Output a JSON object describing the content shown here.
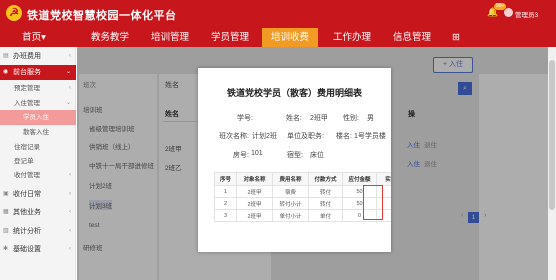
{
  "header": {
    "title": "铁道党校智慧校园一体化平台",
    "emblem_icon": "party-emblem-icon",
    "notification_count": "99+",
    "user": "管理员3"
  },
  "nav": {
    "items": [
      {
        "label": "首页▾"
      },
      {
        "label": "教务教学"
      },
      {
        "label": "培训管理"
      },
      {
        "label": "学员管理"
      },
      {
        "label": "培训收费"
      },
      {
        "label": "工作办理"
      },
      {
        "label": "信息管理"
      },
      {
        "label": "⊞"
      }
    ],
    "active": "培训收费"
  },
  "sidebar": {
    "items": [
      {
        "label": "办班费用",
        "icon": "file-icon"
      },
      {
        "label": "前台服务",
        "icon": "service-icon"
      },
      {
        "label": "预定管理"
      },
      {
        "label": "入住管理"
      },
      {
        "label": "学员入住"
      },
      {
        "label": "散客入住"
      },
      {
        "label": "住宿记录"
      },
      {
        "label": "登记单"
      },
      {
        "label": "收付管理"
      },
      {
        "label": "收付日常",
        "icon": "cash-icon"
      },
      {
        "label": "其他业务",
        "icon": "briefcase-icon"
      },
      {
        "label": "统计分析",
        "icon": "chart-icon"
      },
      {
        "label": "基础设置",
        "icon": "settings-icon"
      }
    ]
  },
  "background": {
    "tree_head": "班次",
    "tree_root": "培训班",
    "tree_items": [
      "省级管理培训班",
      "供销班（线上）",
      "中铁十一局干部进修班",
      "计划2班",
      "计划3班",
      "test"
    ],
    "tree_footer": "研修班",
    "name_label": "姓名",
    "list_head": "姓名",
    "list_rows": [
      "2班甲",
      "2班乙"
    ],
    "add_button": "+ 入住",
    "search_icon": "search-icon",
    "right_head": "操",
    "right_rows": [
      [
        "入住",
        "退住"
      ],
      [
        "入住",
        "退住"
      ]
    ],
    "pager_current": "1"
  },
  "modal": {
    "title": "铁道党校学员（散客）费用明细表",
    "fields": {
      "student_id_label": "学号:",
      "name_label": "姓名:",
      "name_value": "2班甲",
      "gender_label": "性别:",
      "gender_value": "男",
      "class_label": "班次名称:",
      "class_value": "计划2班",
      "unit_label": "单位及职务:",
      "building_label": "楼名:",
      "building_value": "1号学员楼",
      "room_label": "房号:",
      "room_value": "101",
      "bed_label": "宿型:",
      "bed_value": "床位"
    },
    "table": {
      "headers": [
        "序号",
        "对象名称",
        "费用名称",
        "付款方式",
        "应付金额",
        "实"
      ],
      "rows": [
        [
          "1",
          "2班甲",
          "宿费",
          "转付",
          "50",
          ""
        ],
        [
          "2",
          "2班甲",
          "转付小计",
          "转付",
          "50",
          ""
        ],
        [
          "3",
          "2班甲",
          "单付小计",
          "单付",
          "0",
          ""
        ]
      ]
    }
  }
}
